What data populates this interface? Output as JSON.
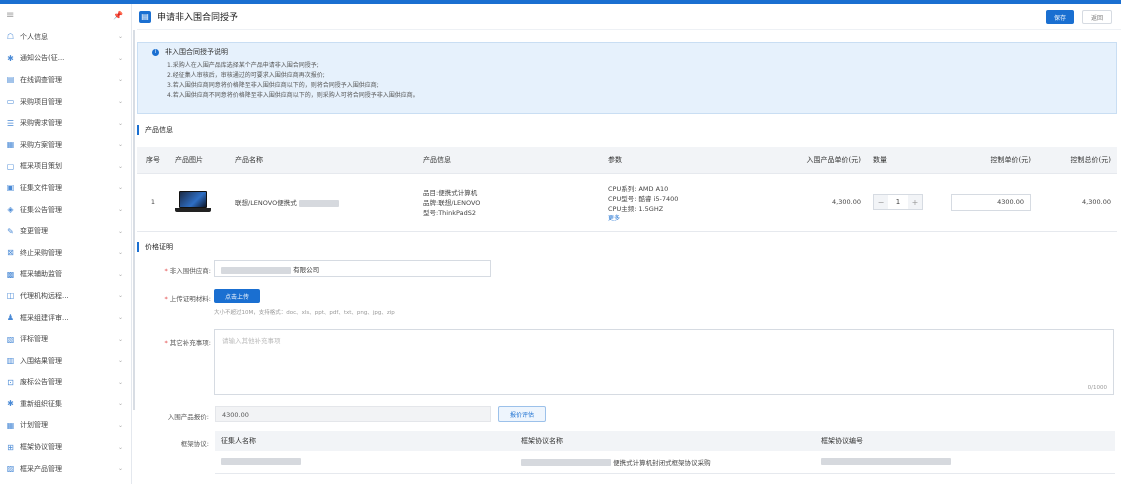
{
  "sidebar": {
    "menu_icon": "hamburger-icon",
    "pin_icon": "pin-icon",
    "items": [
      {
        "label": "个人信息",
        "icon": "user-icon"
      },
      {
        "label": "通知公告(征...",
        "icon": "bell-icon"
      },
      {
        "label": "在线调查管理",
        "icon": "survey-icon"
      },
      {
        "label": "采购项目管理",
        "icon": "folder-icon"
      },
      {
        "label": "采购需求管理",
        "icon": "list-icon"
      },
      {
        "label": "采购方案管理",
        "icon": "plan-icon"
      },
      {
        "label": "框采项目策划",
        "icon": "project-icon"
      },
      {
        "label": "征集文件管理",
        "icon": "file-icon"
      },
      {
        "label": "征集公告管理",
        "icon": "notice-icon"
      },
      {
        "label": "变更管理",
        "icon": "edit-icon"
      },
      {
        "label": "终止采购管理",
        "icon": "stop-icon"
      },
      {
        "label": "框采辅助监管",
        "icon": "monitor-icon"
      },
      {
        "label": "代理机构远程...",
        "icon": "remote-icon"
      },
      {
        "label": "框采组建评审...",
        "icon": "team-icon"
      },
      {
        "label": "评标管理",
        "icon": "review-icon"
      },
      {
        "label": "入围结果管理",
        "icon": "result-icon"
      },
      {
        "label": "废标公告管理",
        "icon": "cancel-icon"
      },
      {
        "label": "重新组织征集",
        "icon": "reorganize-icon"
      },
      {
        "label": "计划管理",
        "icon": "calendar-icon"
      },
      {
        "label": "框架协议管理",
        "icon": "agreement-icon"
      },
      {
        "label": "框采产品管理",
        "icon": "product-icon"
      }
    ]
  },
  "header": {
    "title": "申请非入围合同授予",
    "save_label": "保存",
    "back_label": "返回"
  },
  "notice": {
    "title": "非入围合同授予说明",
    "lines": [
      "1.采购人在入围产品库选择某个产品申请非入围合同授予;",
      "2.经征集人审核后，审核通过的可要求入围供应商再次报价;",
      "3.若入围供应商同意将价格降至非入围供应商以下的，则将合同授予入围供应商;",
      "4.若入围供应商不同意将价格降至非入围供应商以下的，则采购人可将合同授予非入围供应商。"
    ]
  },
  "product_section": {
    "title": "产品信息",
    "columns": [
      "序号",
      "产品图片",
      "产品名称",
      "产品信息",
      "参数",
      "入围产品单价(元)",
      "数量",
      "控制单价(元)",
      "控制总价(元)"
    ],
    "row": {
      "index": "1",
      "name": "联想/LENOVO便携式",
      "info": [
        "品目:便携式计算机",
        "品牌:联想/LENOVO",
        "型号:ThinkPadS2"
      ],
      "params": [
        "CPU系列: AMD A10",
        "CPU型号: 酷睿 i5-7400",
        "CPU主频: 1.5GHZ"
      ],
      "more": "更多",
      "unit_price": "4,300.00",
      "quantity": "1",
      "control_price": "4300.00",
      "control_total": "4,300.00"
    }
  },
  "price_section": {
    "title": "价格证明",
    "supplier_label": "非入围供应商:",
    "supplier_value": "有限公司",
    "upload_label": "上传证明材料:",
    "upload_button": "点击上传",
    "upload_hint": "大小不超过10M，支持格式：doc、xls、ppt、pdf、txt、png、jpg、zip",
    "remarks_label": "其它补充事项:",
    "remarks_placeholder": "请输入其他补充事项",
    "remarks_counter": "0/1000",
    "quote_label": "入围产品报价:",
    "quote_value": "4300.00",
    "eval_button": "报价评估",
    "framework_label": "框架协议:",
    "framework_columns": [
      "征集人名称",
      "框架协议名称",
      "框架协议编号"
    ],
    "framework_row": {
      "agreement_name": "便携式计算机封闭式框架协议采购"
    }
  }
}
